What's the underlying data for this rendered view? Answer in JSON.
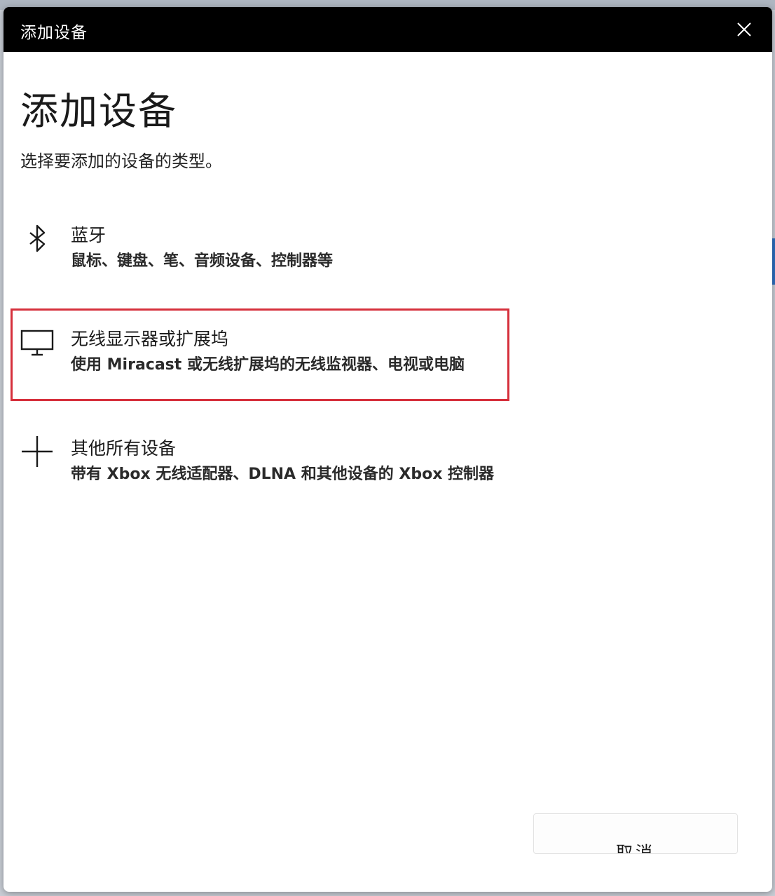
{
  "window": {
    "title": "添加设备",
    "close_icon": "close-icon"
  },
  "dialog": {
    "heading": "添加设备",
    "subtitle": "选择要添加的设备的类型。",
    "options": [
      {
        "icon": "bluetooth-icon",
        "title": "蓝牙",
        "description": "鼠标、键盘、笔、音频设备、控制器等"
      },
      {
        "icon": "monitor-icon",
        "title": "无线显示器或扩展坞",
        "description": "使用 Miracast 或无线扩展坞的无线监视器、电视或电脑",
        "highlighted": true
      },
      {
        "icon": "plus-icon",
        "title": "其他所有设备",
        "description": "带有 Xbox 无线适配器、DLNA 和其他设备的 Xbox 控制器"
      }
    ],
    "cancel_label": "取消"
  },
  "colors": {
    "titlebar": "#000000",
    "highlight_border": "#d6303c",
    "text": "#1a1a1a"
  }
}
